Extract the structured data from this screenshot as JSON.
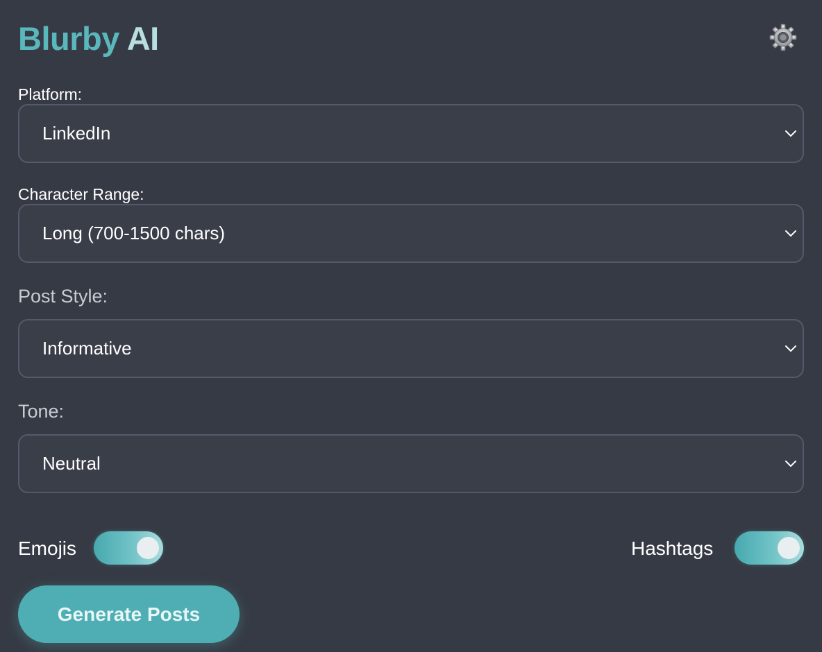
{
  "app": {
    "brand_part1": "Blurby",
    "brand_part2": "AI",
    "settings_icon": "gear-icon"
  },
  "form": {
    "platform": {
      "label": "Platform:",
      "value": "LinkedIn"
    },
    "character_range": {
      "label": "Character Range:",
      "value": "Long (700-1500 chars)"
    },
    "post_style": {
      "label": "Post Style:",
      "value": "Informative"
    },
    "tone": {
      "label": "Tone:",
      "value": "Neutral"
    }
  },
  "toggles": {
    "emojis": {
      "label": "Emojis",
      "on": true
    },
    "hashtags": {
      "label": "Hashtags",
      "on": true
    }
  },
  "actions": {
    "generate_label": "Generate Posts"
  },
  "colors": {
    "background": "#363a44",
    "accent": "#5ab8bd",
    "accent_light": "#b9dde0",
    "field_border": "#55596a"
  }
}
